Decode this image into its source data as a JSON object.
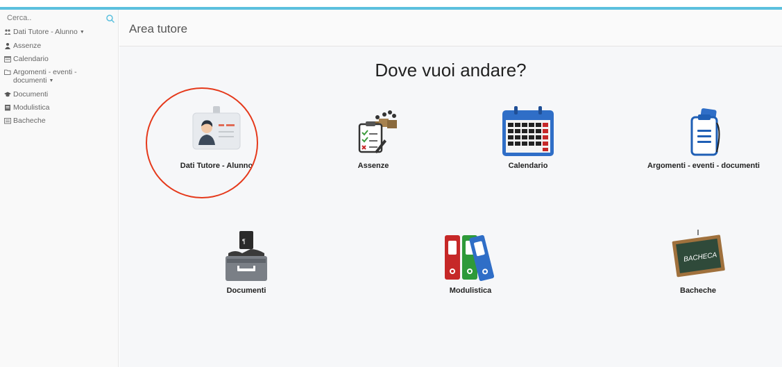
{
  "sidebar": {
    "search": {
      "placeholder": "Cerca.."
    },
    "items": [
      {
        "label": "Dati Tutore - Alunno",
        "icon": "users-icon",
        "has_submenu": true
      },
      {
        "label": "Assenze",
        "icon": "user-icon",
        "has_submenu": false
      },
      {
        "label": "Calendario",
        "icon": "calendar-icon",
        "has_submenu": false
      },
      {
        "label": "Argomenti - eventi - documenti",
        "icon": "folder-open-icon",
        "has_submenu": true
      },
      {
        "label": "Documenti",
        "icon": "graduation-cap-icon",
        "has_submenu": false
      },
      {
        "label": "Modulistica",
        "icon": "document-icon",
        "has_submenu": false
      },
      {
        "label": "Bacheche",
        "icon": "list-icon",
        "has_submenu": false
      }
    ],
    "submenu_marker": "▼"
  },
  "header": {
    "title": "Area tutore"
  },
  "main": {
    "heading": "Dove vuoi andare?",
    "tiles": [
      {
        "label": "Dati Tutore - Alunno",
        "icon": "id-badge-icon"
      },
      {
        "label": "Assenze",
        "icon": "attendance-checklist-icon"
      },
      {
        "label": "Calendario",
        "icon": "calendar-icon"
      },
      {
        "label": "Argomenti - eventi - documenti",
        "icon": "clipboard-document-icon"
      },
      {
        "label": "Documenti",
        "icon": "document-tray-icon"
      },
      {
        "label": "Modulistica",
        "icon": "binders-icon"
      },
      {
        "label": "Bacheche",
        "icon": "chalkboard-icon"
      }
    ],
    "chalkboard_text": "BACHECA"
  },
  "colors": {
    "accent": "#5bc0de",
    "highlight": "#e5391b",
    "calendar_blue": "#2f6ec7",
    "calendar_red": "#c62828"
  }
}
